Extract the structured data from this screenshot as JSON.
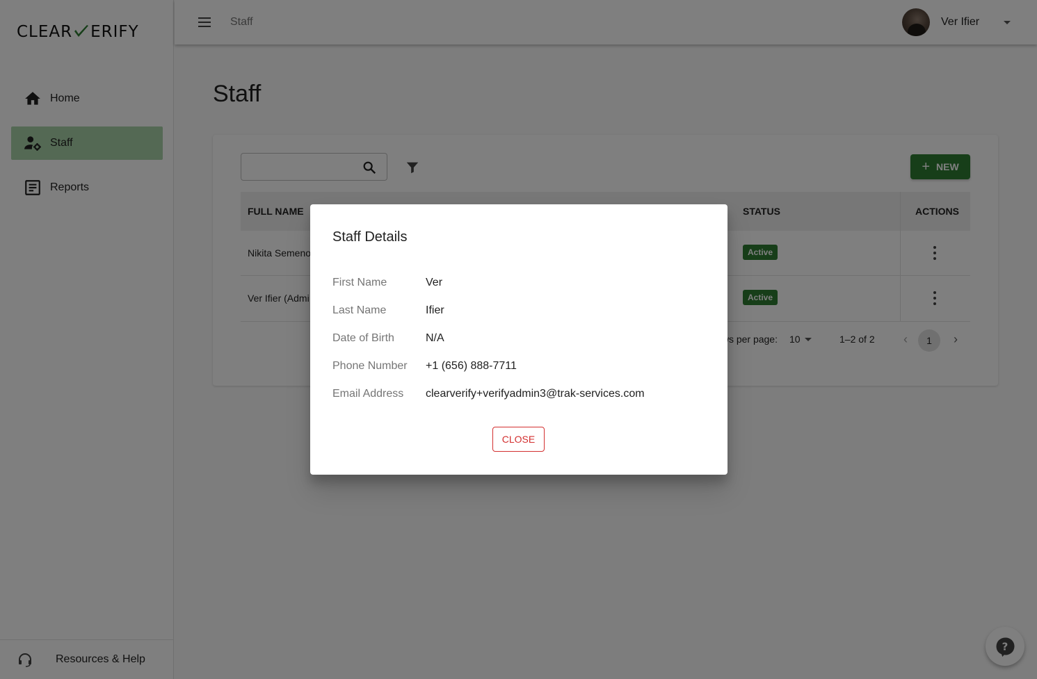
{
  "brand": {
    "logo_left": "CLEAR",
    "logo_right": "ERIFY",
    "accent": "#2e7d32"
  },
  "sidebar": {
    "items": [
      {
        "label": "Home",
        "icon": "home-icon"
      },
      {
        "label": "Staff",
        "icon": "staff-settings-icon",
        "active": true
      },
      {
        "label": "Reports",
        "icon": "reports-icon"
      }
    ],
    "footer": {
      "label": "Resources & Help",
      "icon": "headset-icon"
    }
  },
  "topbar": {
    "title": "Staff",
    "user_name": "Ver Ifier"
  },
  "main": {
    "page_title": "Staff",
    "search": {
      "placeholder": "",
      "value": ""
    },
    "new_button": "NEW",
    "table": {
      "headers": {
        "full_name": "FULL NAME",
        "status": "STATUS",
        "actions": "ACTIONS"
      },
      "rows": [
        {
          "full_name": "Nikita Semeno",
          "status": "Active"
        },
        {
          "full_name": "Ver Ifier (Admi",
          "status": "Active"
        }
      ]
    },
    "pagination": {
      "rows_per_page_label": "ws per page:",
      "rows_per_page": "10",
      "range": "1–2 of 2",
      "page": "1"
    }
  },
  "dialog": {
    "title": "Staff Details",
    "fields": [
      {
        "label": "First Name",
        "value": "Ver"
      },
      {
        "label": "Last Name",
        "value": "Ifier"
      },
      {
        "label": "Date of Birth",
        "value": "N/A"
      },
      {
        "label": "Phone Number",
        "value": "+1 (656) 888-7711"
      },
      {
        "label": "Email Address",
        "value": "clearverify+verifyadmin3@trak-services.com"
      }
    ],
    "close_label": "CLOSE"
  }
}
